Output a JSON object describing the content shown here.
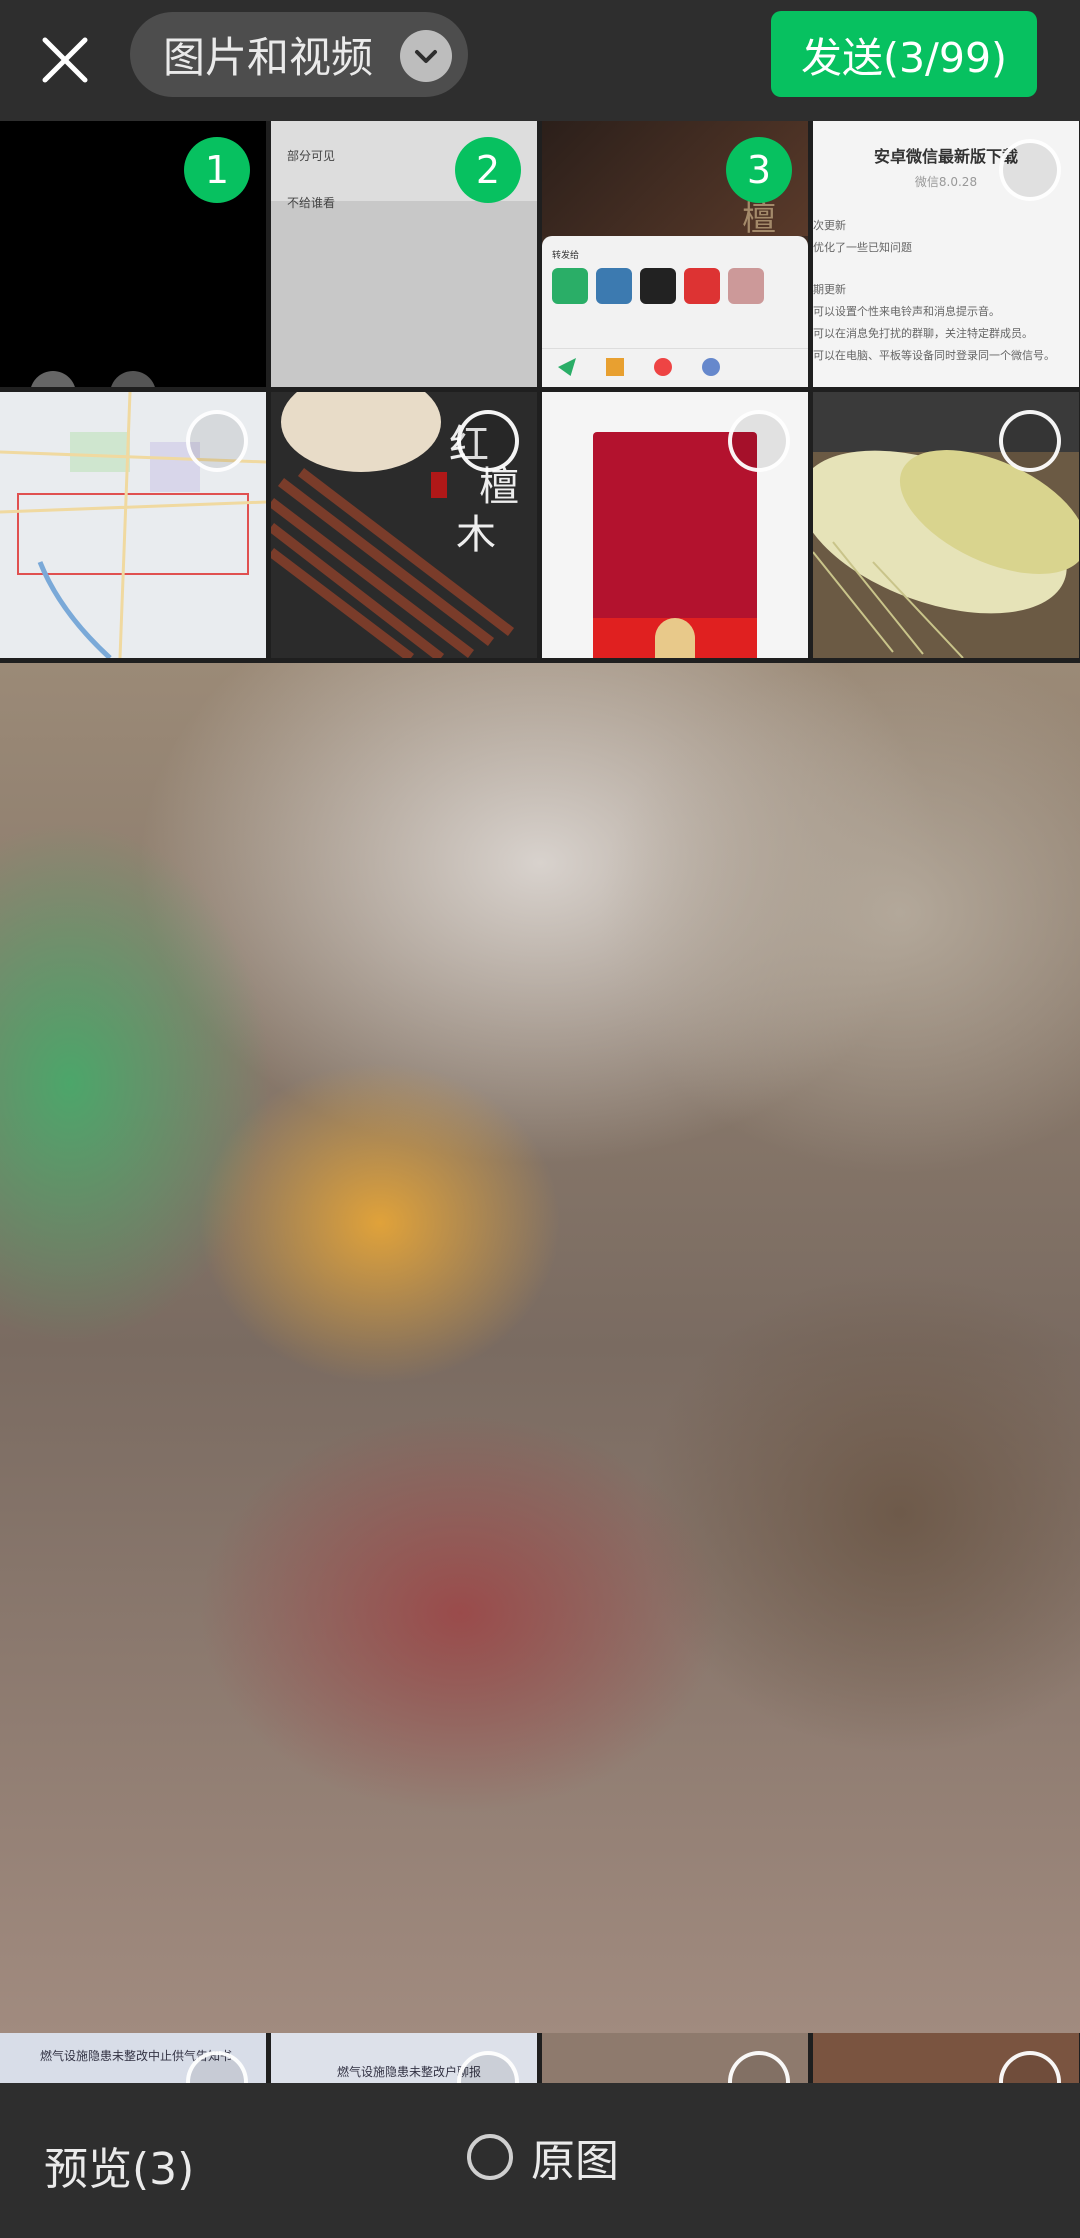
{
  "topbar": {
    "close_icon": "close-icon",
    "album_label": "图片和视频",
    "album_dropdown_icon": "chevron-down-icon",
    "send_label": "发送(3/99)"
  },
  "grid": {
    "items": [
      {
        "name": "photo-1",
        "selected_number": "1"
      },
      {
        "name": "photo-2",
        "selected_number": "2",
        "text_lines": [
          "部分可见",
          "不给谁看"
        ]
      },
      {
        "name": "photo-3",
        "selected_number": "3",
        "overlay_text": "檀",
        "panel_title": "转发给"
      },
      {
        "name": "photo-4",
        "title": "安卓微信最新版下载",
        "subtitle": "微信8.0.28",
        "lines": [
          "次更新",
          "优化了一些已知问题",
          "期更新",
          "可以设置个性来电铃声和消息提示音。",
          "可以在消息免打扰的群聊，关注特定群成员。",
          "可以在电脑、平板等设备同时登录同一个微信号。"
        ]
      },
      {
        "name": "photo-5"
      },
      {
        "name": "photo-6",
        "overlay_text_1": "红",
        "overlay_text_2": "檀",
        "overlay_text_3": "木"
      },
      {
        "name": "photo-7"
      },
      {
        "name": "photo-8"
      },
      {
        "name": "photo-9",
        "caption": "燃气设施隐患未整改中止供气告知书"
      },
      {
        "name": "photo-10",
        "caption": "燃气设施隐患未整改户聊报"
      },
      {
        "name": "photo-11"
      },
      {
        "name": "photo-12"
      }
    ]
  },
  "bottombar": {
    "preview_label": "预览(3)",
    "original_label": "原图"
  },
  "colors": {
    "accent": "#07c160",
    "bar_bg": "#2e2e2e"
  }
}
